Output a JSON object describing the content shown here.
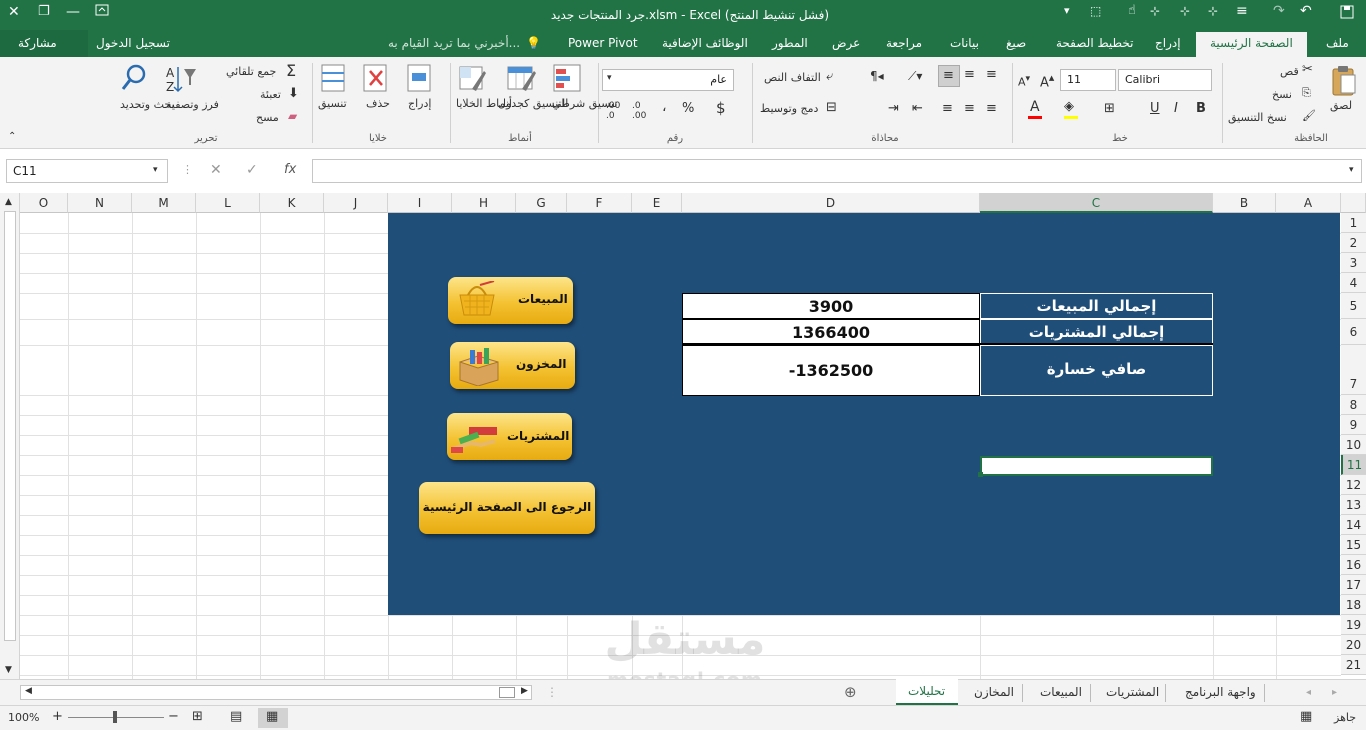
{
  "titlebar": {
    "title": "جرد المنتجات جديد.xlsm - Excel (فشل تنشيط المنتج)",
    "close": "✕",
    "restore": "❐",
    "minimize": "—"
  },
  "tabs": {
    "file": "ملف",
    "home": "الصفحة الرئيسية",
    "insert": "إدراج",
    "page_layout": "تخطيط الصفحة",
    "formulas": "صيغ",
    "data": "بيانات",
    "review": "مراجعة",
    "view": "عرض",
    "developer": "المطور",
    "addins": "الوظائف الإضافية",
    "powerpivot": "Power Pivot",
    "tell_me": "أخبرني بما تريد القيام به...",
    "signin": "تسجيل الدخول",
    "share": "مشاركة"
  },
  "ribbon": {
    "clipboard": {
      "group": "الحافظة",
      "paste": "لصق",
      "cut": "قص",
      "copy": "نسخ",
      "format_painter": "نسخ التنسيق"
    },
    "font": {
      "group": "خط",
      "font_name": "Calibri",
      "font_size": "11",
      "bold": "B",
      "italic": "I",
      "underline": "U"
    },
    "alignment": {
      "group": "محاذاة",
      "wrap": "التفاف النص",
      "merge": "دمج وتوسيط"
    },
    "number": {
      "group": "رقم",
      "format": "عام",
      "currency": "$",
      "percent": "%",
      "comma": "،"
    },
    "styles": {
      "group": "أنماط",
      "conditional": "تنسيق شرطي",
      "as_table": "التنسيق كجدول",
      "cell_styles": "أنماط الخلايا"
    },
    "cells": {
      "group": "خلايا",
      "insert": "إدراج",
      "delete": "حذف",
      "format": "تنسيق"
    },
    "editing": {
      "group": "تحرير",
      "autosum": "جمع تلقائي",
      "fill": "تعبئة",
      "clear": "مسح",
      "sort": "فرز وتصفية",
      "find": "بحث وتحديد"
    }
  },
  "formula_bar": {
    "namebox": "C11",
    "fx": "fx",
    "value": ""
  },
  "columns": [
    "A",
    "B",
    "C",
    "D",
    "E",
    "F",
    "G",
    "H",
    "I",
    "J",
    "K",
    "L",
    "M",
    "N",
    "O"
  ],
  "rows": [
    "1",
    "2",
    "3",
    "4",
    "5",
    "6",
    "7",
    "8",
    "9",
    "10",
    "11",
    "12",
    "13",
    "14",
    "15",
    "16",
    "17",
    "18",
    "19",
    "20",
    "21"
  ],
  "summary": {
    "sales_label": "إجمالي المبيعات",
    "sales_value": "3900",
    "purchases_label": "إجمالي المشتريات",
    "purchases_value": "1366400",
    "net_label": "صافي خسارة",
    "net_value": "-1362500"
  },
  "buttons": {
    "sales": "المبيعات",
    "inventory": "المخزون",
    "purchases": "المشتريات",
    "back": "الرجوع الى الصفحة الرئيسية"
  },
  "sheet_tabs": [
    "واجهة البرنامج",
    "المشتريات",
    "المبيعات",
    "المخازن",
    "تحليلات"
  ],
  "active_sheet": "تحليلات",
  "status": {
    "ready": "جاهز",
    "zoom": "100%"
  },
  "watermark": {
    "ar": "مستقل",
    "en": "mostaql.com"
  },
  "colors": {
    "excel_green": "#217346",
    "panel_blue": "#1f4e79",
    "button_gold": "#f4c232"
  }
}
